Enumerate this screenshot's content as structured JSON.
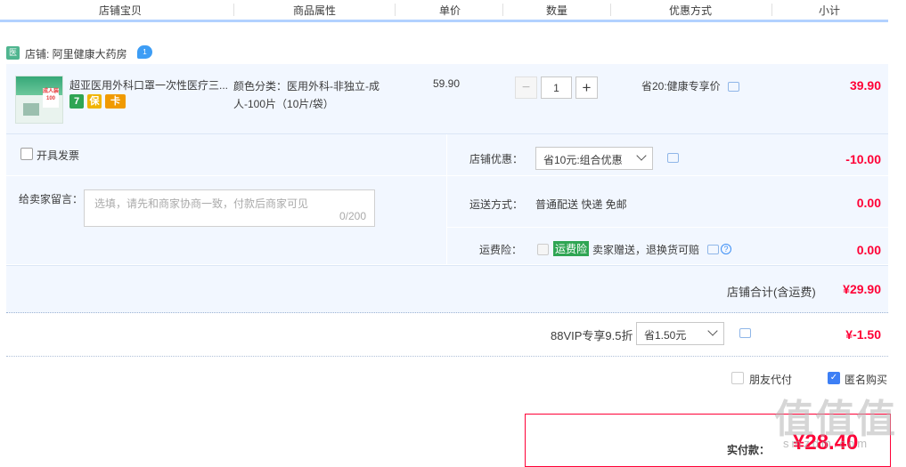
{
  "columns": [
    "店铺宝贝",
    "商品属性",
    "单价",
    "数量",
    "优惠方式",
    "小计"
  ],
  "shop": {
    "name": "店铺: 阿里健康大药房",
    "ww_badge": "1"
  },
  "item": {
    "title": "超亚医用外科口罩一次性医疗三...",
    "props": "颜色分类：医用外科-非独立-成人-100片（10片/袋）",
    "price": "59.90",
    "quantity": "1",
    "promo": "省20:健康专享价",
    "subtotal": "39.90",
    "badges": [
      "7",
      "保",
      "卡"
    ],
    "thumb_text": "成人装 100"
  },
  "options": {
    "invoice_label": "开具发票",
    "memo_label": "给卖家留言：",
    "memo_placeholder": "选填，请先和商家协商一致，付款后商家可见",
    "memo_count": "0/200",
    "shop_discount_label": "店铺优惠：",
    "shop_discount_value": "省10元:组合优惠",
    "shop_discount_amount": "-10.00",
    "shipping_label": "运送方式：",
    "shipping_value": "普通配送 快递 免邮",
    "shipping_amount": "0.00",
    "insurance_label": "运费险：",
    "insurance_tag": "运费险",
    "insurance_text": "卖家赠送，退换货可赔",
    "insurance_amount": "0.00"
  },
  "shop_total": {
    "label": "店铺合计(含运费)",
    "amount": "¥29.90"
  },
  "vip": {
    "label": "88VIP专享9.5折",
    "select_value": "省1.50元",
    "amount": "¥-1.50"
  },
  "pay_options": {
    "friend_pay": "朋友代付",
    "anonymous": "匿名购买"
  },
  "payment": {
    "label": "实付款：",
    "amount": "¥28.40"
  },
  "watermark": {
    "main": "值值值",
    "sub": "smzdm.com"
  },
  "colors": {
    "accent_red": "#ff0036",
    "light_blue_bg": "#f2f7ff",
    "header_border": "#b2d1ff"
  }
}
